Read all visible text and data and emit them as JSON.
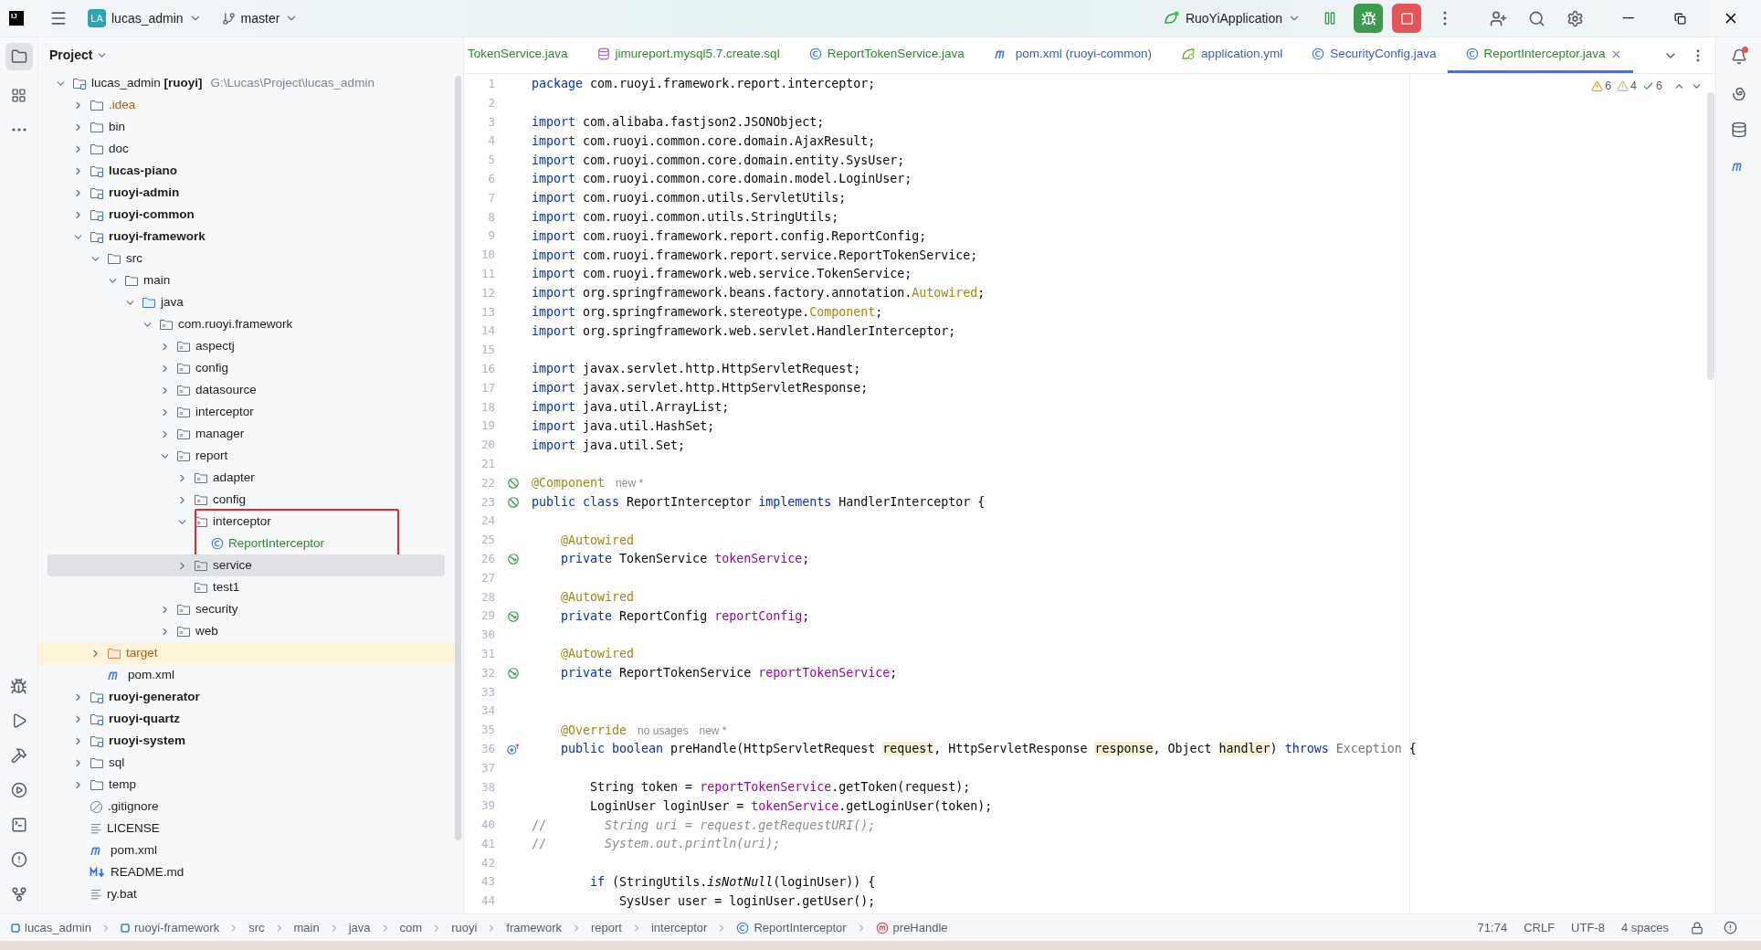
{
  "title_bar": {
    "logo": "IJ",
    "project_badge": "LA",
    "project": "lucas_admin",
    "branch": "master",
    "run_config": "RuoYiApplication"
  },
  "project_panel": {
    "title": "Project",
    "tree": [
      {
        "kind": "module",
        "label": "lucas_admin **[ruoyi]**",
        "path": "G:\\Lucas\\Project\\lucas_admin",
        "expanded": true,
        "selected": false,
        "children": [
          {
            "kind": "config-folder",
            "label": ".idea",
            "expanded": false,
            "selected": false
          },
          {
            "kind": "folder",
            "label": "bin",
            "expanded": false,
            "selected": false
          },
          {
            "kind": "folder",
            "label": "doc",
            "expanded": false,
            "selected": false
          },
          {
            "kind": "module",
            "label": "lucas-piano",
            "bold": true,
            "expanded": false,
            "selected": false
          },
          {
            "kind": "module",
            "label": "ruoyi-admin",
            "bold": true,
            "expanded": false,
            "selected": false
          },
          {
            "kind": "module",
            "label": "ruoyi-common",
            "bold": true,
            "expanded": false,
            "selected": false
          },
          {
            "kind": "module",
            "label": "ruoyi-framework",
            "bold": true,
            "expanded": true,
            "selected": false,
            "children": [
              {
                "kind": "folder",
                "label": "src",
                "expanded": true,
                "selected": false,
                "children": [
                  {
                    "kind": "folder",
                    "label": "main",
                    "expanded": true,
                    "selected": false,
                    "children": [
                      {
                        "kind": "source-root",
                        "label": "java",
                        "expanded": true,
                        "selected": false,
                        "children": [
                          {
                            "kind": "package",
                            "label": "com.ruoyi.framework",
                            "expanded": true,
                            "selected": false,
                            "children": [
                              {
                                "kind": "package",
                                "label": "aspectj",
                                "expanded": false,
                                "selected": false
                              },
                              {
                                "kind": "package",
                                "label": "config",
                                "expanded": false,
                                "selected": false
                              },
                              {
                                "kind": "package",
                                "label": "datasource",
                                "expanded": false,
                                "selected": false
                              },
                              {
                                "kind": "package",
                                "label": "interceptor",
                                "expanded": false,
                                "selected": false
                              },
                              {
                                "kind": "package",
                                "label": "manager",
                                "expanded": false,
                                "selected": false
                              },
                              {
                                "kind": "package",
                                "label": "report",
                                "expanded": true,
                                "selected": false,
                                "children": [
                                  {
                                    "kind": "package",
                                    "label": "adapter",
                                    "expanded": false,
                                    "selected": false
                                  },
                                  {
                                    "kind": "package",
                                    "label": "config",
                                    "expanded": false,
                                    "selected": false
                                  },
                                  {
                                    "kind": "package",
                                    "label": "interceptor",
                                    "expanded": true,
                                    "selected": false,
                                    "boxed": true,
                                    "children": [
                                      {
                                        "kind": "class",
                                        "label": "ReportInterceptor",
                                        "color": "#2f8a2f",
                                        "selected": false
                                      }
                                    ]
                                  },
                                  {
                                    "kind": "package",
                                    "label": "service",
                                    "expanded": false,
                                    "selected": true
                                  },
                                  {
                                    "kind": "package",
                                    "label": "test1",
                                    "selected": false
                                  }
                                ]
                              },
                              {
                                "kind": "package",
                                "label": "security",
                                "expanded": false,
                                "selected": false
                              },
                              {
                                "kind": "package",
                                "label": "web",
                                "expanded": false,
                                "selected": false
                              }
                            ]
                          }
                        ]
                      }
                    ]
                  }
                ]
              },
              {
                "kind": "excluded",
                "label": "target",
                "expanded": false,
                "selected": false
              },
              {
                "kind": "maven",
                "label": "pom.xml",
                "selected": false
              }
            ]
          },
          {
            "kind": "module",
            "label": "ruoyi-generator",
            "bold": true,
            "expanded": false,
            "selected": false
          },
          {
            "kind": "module",
            "label": "ruoyi-quartz",
            "bold": true,
            "expanded": false,
            "selected": false
          },
          {
            "kind": "module",
            "label": "ruoyi-system",
            "bold": true,
            "expanded": false,
            "selected": false
          },
          {
            "kind": "folder",
            "label": "sql",
            "expanded": false,
            "selected": false
          },
          {
            "kind": "folder",
            "label": "temp",
            "expanded": false,
            "selected": false
          },
          {
            "kind": "ignore",
            "label": ".gitignore",
            "selected": false
          },
          {
            "kind": "text",
            "label": "LICENSE",
            "selected": false
          },
          {
            "kind": "maven",
            "label": "pom.xml",
            "selected": false
          },
          {
            "kind": "markdown",
            "label": "README.md",
            "selected": false
          },
          {
            "kind": "text",
            "label": "ry.bat",
            "selected": false
          }
        ]
      }
    ]
  },
  "tabs": [
    {
      "kind": "none",
      "label": "TokenService.java",
      "color": "#2f8a2f",
      "selected": false
    },
    {
      "kind": "database",
      "label": "jimureport.mysql5.7.create.sql",
      "color": "#2f8a2f",
      "selected": false
    },
    {
      "kind": "class",
      "label": "ReportTokenService.java",
      "color": "#2f8a2f",
      "selected": false
    },
    {
      "kind": "maven",
      "label": "pom.xml (ruoyi-common)",
      "color": "#3d5fb5",
      "selected": false
    },
    {
      "kind": "spring",
      "label": "application.yml",
      "color": "#3d5fb5",
      "selected": false
    },
    {
      "kind": "class",
      "label": "SecurityConfig.java",
      "color": "#3d5fb5",
      "selected": false
    },
    {
      "kind": "class",
      "label": "ReportInterceptor.java",
      "color": "#2f8a2f",
      "selected": true
    }
  ],
  "inspections": {
    "warnings": "6",
    "weak_warnings": "4",
    "ok": "6"
  },
  "code": [
    {
      "number": "1",
      "tokens": [
        {
          "kind": "keyword",
          "text": "package"
        },
        {
          "kind": "plain",
          "text": " com.ruoyi.framework.report.interceptor;"
        }
      ]
    },
    {
      "number": "2"
    },
    {
      "number": "3",
      "tokens": [
        {
          "kind": "keyword",
          "text": "import"
        },
        {
          "kind": "plain",
          "text": " com.alibaba.fastjson2.JSONObject;"
        }
      ]
    },
    {
      "number": "4",
      "tokens": [
        {
          "kind": "keyword",
          "text": "import"
        },
        {
          "kind": "plain",
          "text": " com.ruoyi.common.core.domain.AjaxResult;"
        }
      ]
    },
    {
      "number": "5",
      "tokens": [
        {
          "kind": "keyword",
          "text": "import"
        },
        {
          "kind": "plain",
          "text": " com.ruoyi.common.core.domain.entity.SysUser;"
        }
      ]
    },
    {
      "number": "6",
      "tokens": [
        {
          "kind": "keyword",
          "text": "import"
        },
        {
          "kind": "plain",
          "text": " com.ruoyi.common.core.domain.model.LoginUser;"
        }
      ]
    },
    {
      "number": "7",
      "tokens": [
        {
          "kind": "keyword",
          "text": "import"
        },
        {
          "kind": "plain",
          "text": " com.ruoyi.common.utils.ServletUtils;"
        }
      ]
    },
    {
      "number": "8",
      "tokens": [
        {
          "kind": "keyword",
          "text": "import"
        },
        {
          "kind": "plain",
          "text": " com.ruoyi.common.utils.StringUtils;"
        }
      ]
    },
    {
      "number": "9",
      "tokens": [
        {
          "kind": "keyword",
          "text": "import"
        },
        {
          "kind": "plain",
          "text": " com.ruoyi.framework.report.config.ReportConfig;"
        }
      ]
    },
    {
      "number": "10",
      "tokens": [
        {
          "kind": "keyword",
          "text": "import"
        },
        {
          "kind": "plain",
          "text": " com.ruoyi.framework.report.service.ReportTokenService;"
        }
      ]
    },
    {
      "number": "11",
      "tokens": [
        {
          "kind": "keyword",
          "text": "import"
        },
        {
          "kind": "plain",
          "text": " com.ruoyi.framework.web.service.TokenService;"
        }
      ]
    },
    {
      "number": "12",
      "tokens": [
        {
          "kind": "keyword",
          "text": "import"
        },
        {
          "kind": "plain",
          "text": " org.springframework.beans.factory.annotation."
        },
        {
          "kind": "annotation",
          "text": "Autowired"
        },
        {
          "kind": "plain",
          "text": ";"
        }
      ]
    },
    {
      "number": "13",
      "tokens": [
        {
          "kind": "keyword",
          "text": "import"
        },
        {
          "kind": "plain",
          "text": " org.springframework.stereotype."
        },
        {
          "kind": "annotation",
          "text": "Component"
        },
        {
          "kind": "plain",
          "text": ";"
        }
      ]
    },
    {
      "number": "14",
      "tokens": [
        {
          "kind": "keyword",
          "text": "import"
        },
        {
          "kind": "plain",
          "text": " org.springframework.web.servlet.HandlerInterceptor;"
        }
      ]
    },
    {
      "number": "15"
    },
    {
      "number": "16",
      "tokens": [
        {
          "kind": "keyword",
          "text": "import"
        },
        {
          "kind": "plain",
          "text": " javax.servlet.http.HttpServletRequest;"
        }
      ]
    },
    {
      "number": "17",
      "tokens": [
        {
          "kind": "keyword",
          "text": "import"
        },
        {
          "kind": "plain",
          "text": " javax.servlet.http.HttpServletResponse;"
        }
      ]
    },
    {
      "number": "18",
      "tokens": [
        {
          "kind": "keyword",
          "text": "import"
        },
        {
          "kind": "plain",
          "text": " java.util.ArrayList;"
        }
      ]
    },
    {
      "number": "19",
      "tokens": [
        {
          "kind": "keyword",
          "text": "import"
        },
        {
          "kind": "plain",
          "text": " java.util.HashSet;"
        }
      ]
    },
    {
      "number": "20",
      "tokens": [
        {
          "kind": "keyword",
          "text": "import"
        },
        {
          "kind": "plain",
          "text": " java.util.Set;"
        }
      ]
    },
    {
      "number": "21"
    },
    {
      "number": "22",
      "gutter": {
        "kind": "bean"
      },
      "tokens": [
        {
          "kind": "annotation",
          "text": "@Component"
        },
        {
          "kind": "hint",
          "text": "new *"
        }
      ]
    },
    {
      "number": "23",
      "gutter": {
        "kind": "bean"
      },
      "tokens": [
        {
          "kind": "keyword",
          "text": "public class"
        },
        {
          "kind": "plain",
          "text": " ReportInterceptor "
        },
        {
          "kind": "keyword",
          "text": "implements"
        },
        {
          "kind": "plain",
          "text": " HandlerInterceptor {"
        }
      ]
    },
    {
      "number": "24"
    },
    {
      "number": "25",
      "tokens": [
        {
          "kind": "annotation",
          "text": "    @Autowired"
        }
      ]
    },
    {
      "number": "26",
      "gutter": {
        "kind": "inject"
      },
      "tokens": [
        {
          "kind": "keyword",
          "text": "    private"
        },
        {
          "kind": "plain",
          "text": " TokenService "
        },
        {
          "kind": "field",
          "text": "tokenService"
        },
        {
          "kind": "plain",
          "text": ";"
        }
      ]
    },
    {
      "number": "27"
    },
    {
      "number": "28",
      "tokens": [
        {
          "kind": "annotation",
          "text": "    @Autowired"
        }
      ]
    },
    {
      "number": "29",
      "gutter": {
        "kind": "inject"
      },
      "tokens": [
        {
          "kind": "keyword",
          "text": "    private"
        },
        {
          "kind": "plain",
          "text": " ReportConfig "
        },
        {
          "kind": "field",
          "text": "reportConfig"
        },
        {
          "kind": "plain",
          "text": ";"
        }
      ]
    },
    {
      "number": "30"
    },
    {
      "number": "31",
      "tokens": [
        {
          "kind": "annotation",
          "text": "    @Autowired"
        }
      ]
    },
    {
      "number": "32",
      "gutter": {
        "kind": "inject"
      },
      "tokens": [
        {
          "kind": "keyword",
          "text": "    private"
        },
        {
          "kind": "plain",
          "text": " ReportTokenService "
        },
        {
          "kind": "field",
          "text": "reportTokenService"
        },
        {
          "kind": "plain",
          "text": ";"
        }
      ]
    },
    {
      "number": "33"
    },
    {
      "number": "34"
    },
    {
      "number": "35",
      "tokens": [
        {
          "kind": "annotation",
          "text": "    @Override"
        },
        {
          "kind": "hint",
          "text": "no usages"
        },
        {
          "kind": "hint",
          "text": "new *"
        }
      ]
    },
    {
      "number": "36",
      "gutter": {
        "kind": "override"
      },
      "tokens": [
        {
          "kind": "keyword",
          "text": "    public boolean"
        },
        {
          "kind": "plain",
          "text": " preHandle(HttpServletRequest "
        },
        {
          "kind": "param",
          "text": "request"
        },
        {
          "kind": "plain",
          "text": ", HttpServletResponse "
        },
        {
          "kind": "param",
          "text": "response"
        },
        {
          "kind": "plain",
          "text": ", Object "
        },
        {
          "kind": "param",
          "text": "handler"
        },
        {
          "kind": "plain",
          "text": ") "
        },
        {
          "kind": "keyword",
          "text": "throws"
        },
        {
          "kind": "unused",
          "text": " Exception"
        },
        {
          "kind": "plain",
          "text": " {"
        }
      ]
    },
    {
      "number": "37"
    },
    {
      "number": "38",
      "tokens": [
        {
          "kind": "plain",
          "text": "        String token = "
        },
        {
          "kind": "field",
          "text": "reportTokenService"
        },
        {
          "kind": "plain",
          "text": ".getToken(request);"
        }
      ]
    },
    {
      "number": "39",
      "tokens": [
        {
          "kind": "plain",
          "text": "        LoginUser loginUser = "
        },
        {
          "kind": "field",
          "text": "tokenService"
        },
        {
          "kind": "plain",
          "text": ".getLoginUser(token);"
        }
      ]
    },
    {
      "number": "40",
      "tokens": [
        {
          "kind": "comment-mark",
          "text": "//"
        },
        {
          "kind": "comment",
          "text": "        String uri = request.getRequestURI();"
        }
      ]
    },
    {
      "number": "41",
      "tokens": [
        {
          "kind": "comment-mark",
          "text": "//"
        },
        {
          "kind": "comment",
          "text": "        System.out.println(uri);"
        }
      ]
    },
    {
      "number": "42"
    },
    {
      "number": "43",
      "tokens": [
        {
          "kind": "keyword",
          "text": "        if"
        },
        {
          "kind": "plain",
          "text": " (StringUtils."
        },
        {
          "kind": "static",
          "text": "isNotNull"
        },
        {
          "kind": "plain",
          "text": "(loginUser)) {"
        }
      ]
    },
    {
      "number": "44",
      "tokens": [
        {
          "kind": "plain",
          "text": "            SysUser user = loginUser.getUser();"
        }
      ]
    }
  ],
  "breadcrumbs": [
    {
      "kind": "module",
      "label": "lucas_admin"
    },
    {
      "kind": "module",
      "label": "ruoyi-framework"
    },
    {
      "kind": "plain",
      "label": "src"
    },
    {
      "kind": "plain",
      "label": "main"
    },
    {
      "kind": "plain",
      "label": "java"
    },
    {
      "kind": "plain",
      "label": "com"
    },
    {
      "kind": "plain",
      "label": "ruoyi"
    },
    {
      "kind": "plain",
      "label": "framework"
    },
    {
      "kind": "plain",
      "label": "report"
    },
    {
      "kind": "plain",
      "label": "interceptor"
    },
    {
      "kind": "class",
      "label": "ReportInterceptor"
    },
    {
      "kind": "method",
      "label": "preHandle"
    }
  ],
  "status_bar": {
    "position": "71:74",
    "line_separator": "CRLF",
    "encoding": "UTF-8",
    "indent": "4 spaces"
  }
}
